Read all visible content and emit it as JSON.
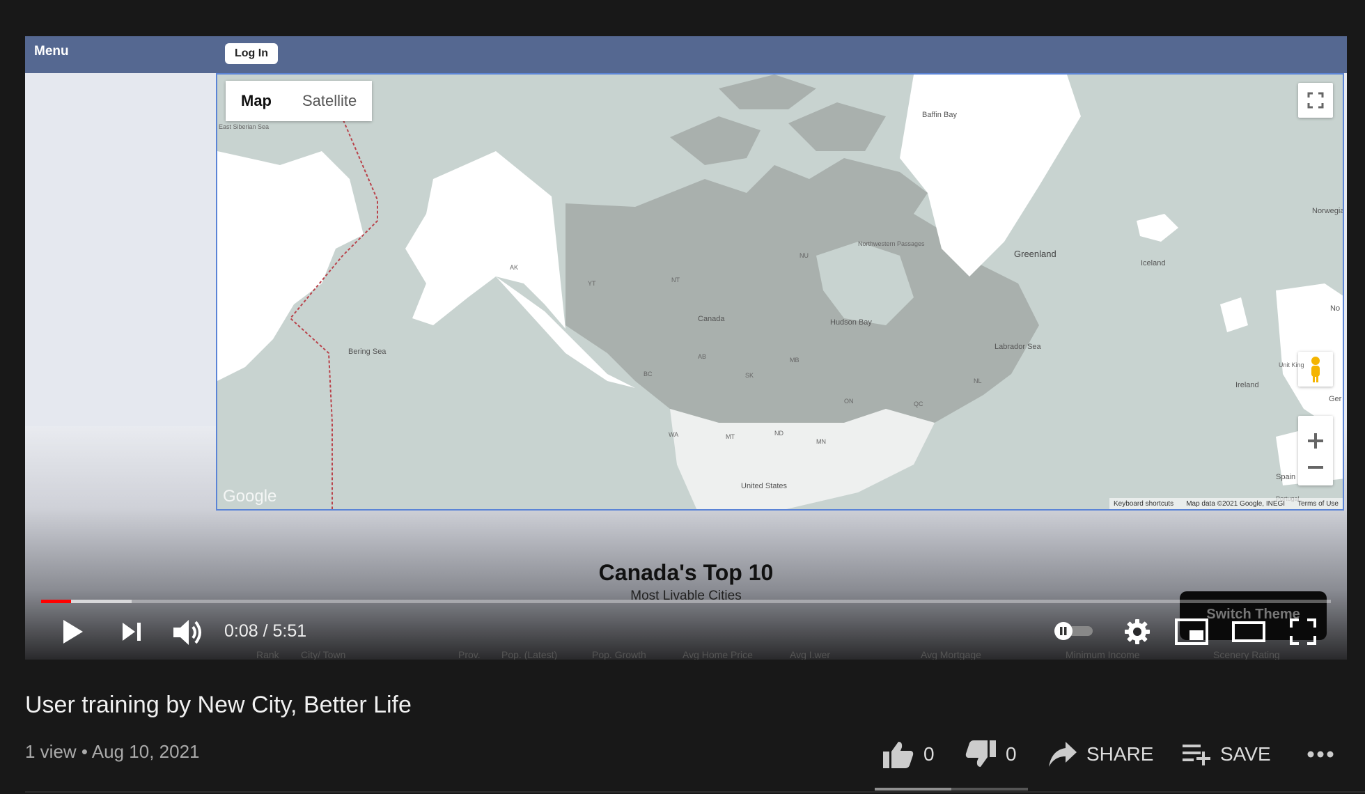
{
  "app": {
    "menu_label": "Menu",
    "login_label": "Log In"
  },
  "map": {
    "type_options": [
      "Map",
      "Satellite"
    ],
    "selected_type": "Map",
    "labels": {
      "east_siberian_sea": "East Siberian Sea",
      "baffin_bay": "Baffin Bay",
      "norwegian_sea": "Norwegian Se",
      "greenland": "Greenland",
      "iceland": "Iceland",
      "northwest_passages": "Northwestern Passages",
      "hudson_bay": "Hudson Bay",
      "labrador_sea": "Labrador Sea",
      "bering_sea": "Bering Sea",
      "canada": "Canada",
      "united_states": "United States",
      "ireland": "Ireland",
      "united_kingdom": "Unit King",
      "spain": "Spain",
      "portugal": "Portugal",
      "no": "No",
      "ger": "Ger",
      "ak": "AK",
      "yt": "YT",
      "nt": "NT",
      "nu": "NU",
      "bc": "BC",
      "ab": "AB",
      "sk": "SK",
      "mb": "MB",
      "on": "ON",
      "qc": "QC",
      "nl": "NL",
      "wa": "WA",
      "mt": "MT",
      "nd": "ND",
      "mn": "MN"
    },
    "watermark": "Google",
    "footer": [
      "Keyboard shortcuts",
      "Map data ©2021 Google, INEGI",
      "Terms of Use"
    ],
    "icons": [
      "fullscreen-icon",
      "pegman-icon",
      "zoom-in-icon",
      "zoom-out-icon"
    ]
  },
  "content": {
    "title": "Canada's Top 10",
    "subtitle": "Most Livable Cities",
    "switch_theme_label": "Switch Theme",
    "table_headers": [
      "Rank",
      "City/ Town",
      "Prov.",
      "Pop. (Latest)",
      "Pop. Growth",
      "Avg Home Price",
      "Avg I.wer",
      "Avg Mortgage",
      "Minimum Income",
      "Scenery Rating"
    ]
  },
  "player": {
    "current_time": "0:08",
    "duration": "5:51",
    "time_text": "0:08 / 5:51",
    "played_fraction": 0.023,
    "buffered_fraction": 0.07,
    "autoplay": "off",
    "icons": [
      "play-icon",
      "next-icon",
      "volume-icon",
      "autoplay-toggle",
      "settings-icon",
      "miniplayer-icon",
      "theater-icon",
      "fullscreen-icon"
    ],
    "accent_color": "#ff0000"
  },
  "video": {
    "title": "User training by New City, Better Life",
    "meta": "1 view • Aug 10, 2021",
    "likes": "0",
    "dislikes": "0",
    "share_label": "SHARE",
    "save_label": "SAVE",
    "like_fraction": 0.5
  }
}
